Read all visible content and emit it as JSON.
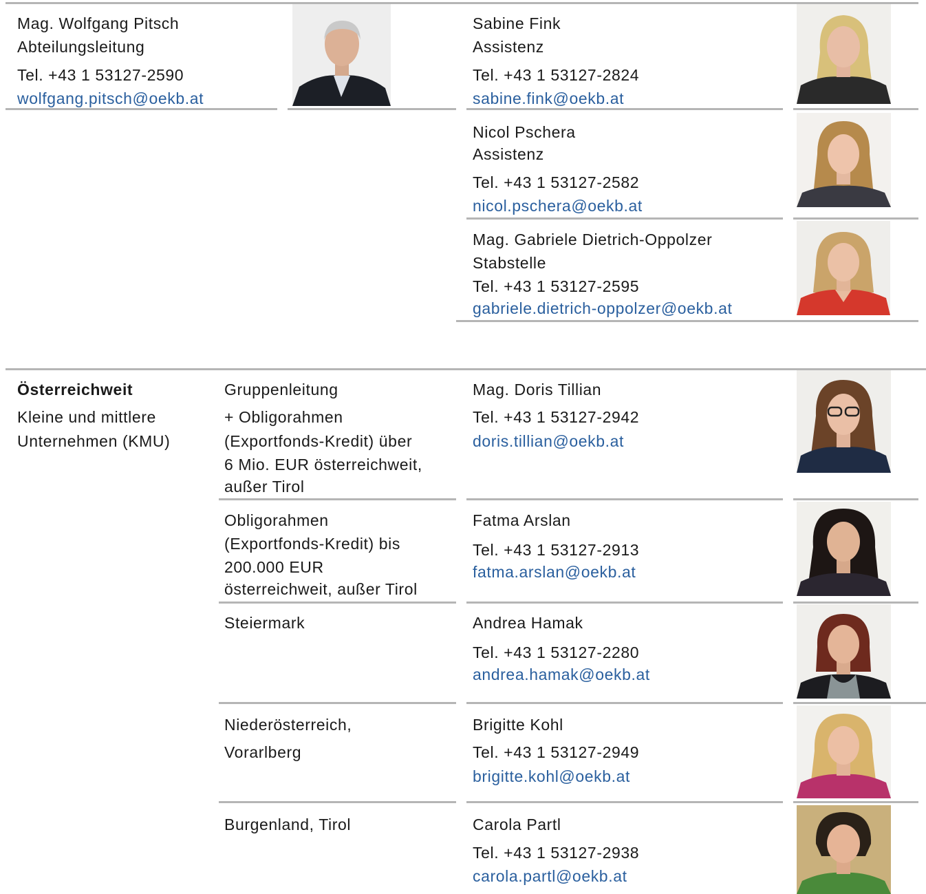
{
  "head": {
    "name": "Mag. Wolfgang Pitsch",
    "role": "Abteilungsleitung",
    "tel": "Tel. +43 1 53127-2590",
    "email": "wolfgang.pitsch@oekb.at"
  },
  "assistants": [
    {
      "name": "Sabine Fink",
      "role": "Assistenz",
      "tel": "Tel. +43 1 53127-2824",
      "email": "sabine.fink@oekb.at"
    },
    {
      "name": "Nicol Pschera",
      "role": "Assistenz",
      "tel": "Tel. +43 1 53127-2582",
      "email": "nicol.pschera@oekb.at"
    },
    {
      "name": "Mag. Gabriele Dietrich-Oppolzer",
      "role": "Stabstelle",
      "tel": "Tel. +43 1 53127-2595",
      "email": "gabriele.dietrich-oppolzer@oekb.at"
    }
  ],
  "section": {
    "title": "Österreichweit",
    "subtitle_lines": [
      "Kleine und mittlere",
      "Unternehmen (KMU)"
    ]
  },
  "groups": [
    {
      "area_lines": [
        "Gruppenleitung",
        "+ Obligorahmen",
        "(Exportfonds-Kredit)  über",
        "6 Mio. EUR österreichweit,",
        "außer Tirol"
      ],
      "name": "Mag. Doris Tillian",
      "tel": "Tel. +43 1 53127-2942",
      "email": "doris.tillian@oekb.at"
    },
    {
      "area_lines": [
        "Obligorahmen",
        "(Exportfonds-Kredit)  bis",
        "200.000 EUR",
        "österreichweit, außer Tirol"
      ],
      "name": "Fatma Arslan",
      "tel": "Tel. +43 1 53127-2913",
      "email": "fatma.arslan@oekb.at"
    },
    {
      "area_lines": [
        "Steiermark"
      ],
      "name": "Andrea Hamak",
      "tel": "Tel. +43 1 53127-2280",
      "email": "andrea.hamak@oekb.at"
    },
    {
      "area_lines": [
        "Niederösterreich,",
        "Vorarlberg"
      ],
      "name": "Brigitte Kohl",
      "tel": "Tel. +43 1 53127-2949",
      "email": "brigitte.kohl@oekb.at"
    },
    {
      "area_lines": [
        "Burgenland,  Tirol"
      ],
      "name": "Carola Partl",
      "tel": "Tel. +43 1 53127-2938",
      "email": "carola.partl@oekb.at"
    }
  ],
  "colors": {
    "link": "#2a5f9e",
    "rule": "#b5b5b5",
    "text": "#1a1a1a"
  }
}
